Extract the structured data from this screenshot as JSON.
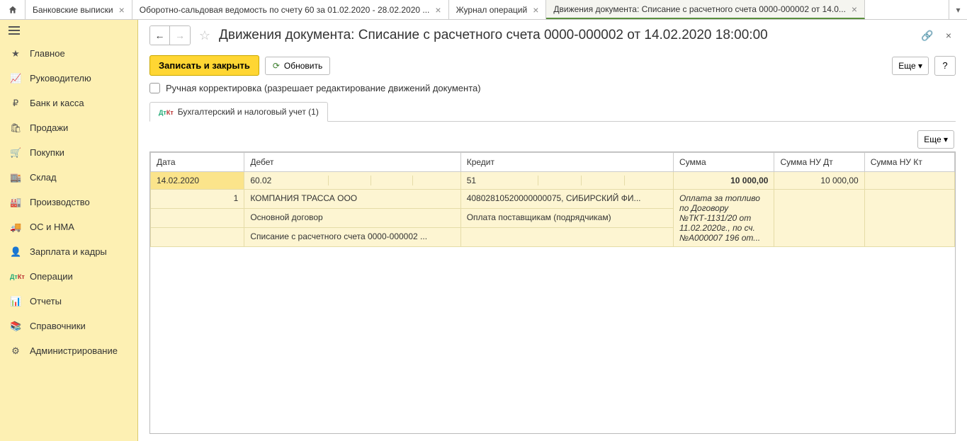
{
  "tabs": [
    {
      "label": "Банковские выписки"
    },
    {
      "label": "Оборотно-сальдовая ведомость по счету 60 за 01.02.2020 - 28.02.2020 ..."
    },
    {
      "label": "Журнал операций"
    },
    {
      "label": "Движения документа: Списание с расчетного счета 0000-000002 от 14.0...",
      "active": true
    }
  ],
  "sidebar": {
    "items": [
      {
        "label": "Главное"
      },
      {
        "label": "Руководителю"
      },
      {
        "label": "Банк и касса"
      },
      {
        "label": "Продажи"
      },
      {
        "label": "Покупки"
      },
      {
        "label": "Склад"
      },
      {
        "label": "Производство"
      },
      {
        "label": "ОС и НМА"
      },
      {
        "label": "Зарплата и кадры"
      },
      {
        "label": "Операции"
      },
      {
        "label": "Отчеты"
      },
      {
        "label": "Справочники"
      },
      {
        "label": "Администрирование"
      }
    ]
  },
  "header": {
    "title": "Движения документа: Списание с расчетного счета 0000-000002 от 14.02.2020 18:00:00"
  },
  "toolbar": {
    "save": "Записать и закрыть",
    "refresh": "Обновить",
    "more": "Еще ▾",
    "help": "?"
  },
  "manual_edit_label": "Ручная корректировка (разрешает редактирование движений документа)",
  "inner_tab": "Бухгалтерский и налоговый учет (1)",
  "table": {
    "more": "Еще ▾",
    "headers": {
      "date": "Дата",
      "debit": "Дебет",
      "credit": "Кредит",
      "sum": "Сумма",
      "sum_nu_dt": "Сумма НУ Дт",
      "sum_nu_kt": "Сумма НУ Кт"
    },
    "row": {
      "date": "14.02.2020",
      "n": "1",
      "debit_acct": "60.02",
      "credit_acct": "51",
      "sum": "10 000,00",
      "sum_nu_dt": "10 000,00",
      "sum_nu_kt": "",
      "debit_sub1": "КОМПАНИЯ ТРАССА ООО",
      "debit_sub2": "Основной договор",
      "debit_sub3": "Списание с расчетного счета 0000-000002 ...",
      "credit_sub1": "40802810520000000075, СИБИРСКИЙ ФИ...",
      "credit_sub2": "Оплата поставщикам (подрядчикам)",
      "desc": "Оплата за топливо по Договору №ТКТ-1131/20 от 11.02.2020г., по сч. №А000007 196 от..."
    }
  }
}
